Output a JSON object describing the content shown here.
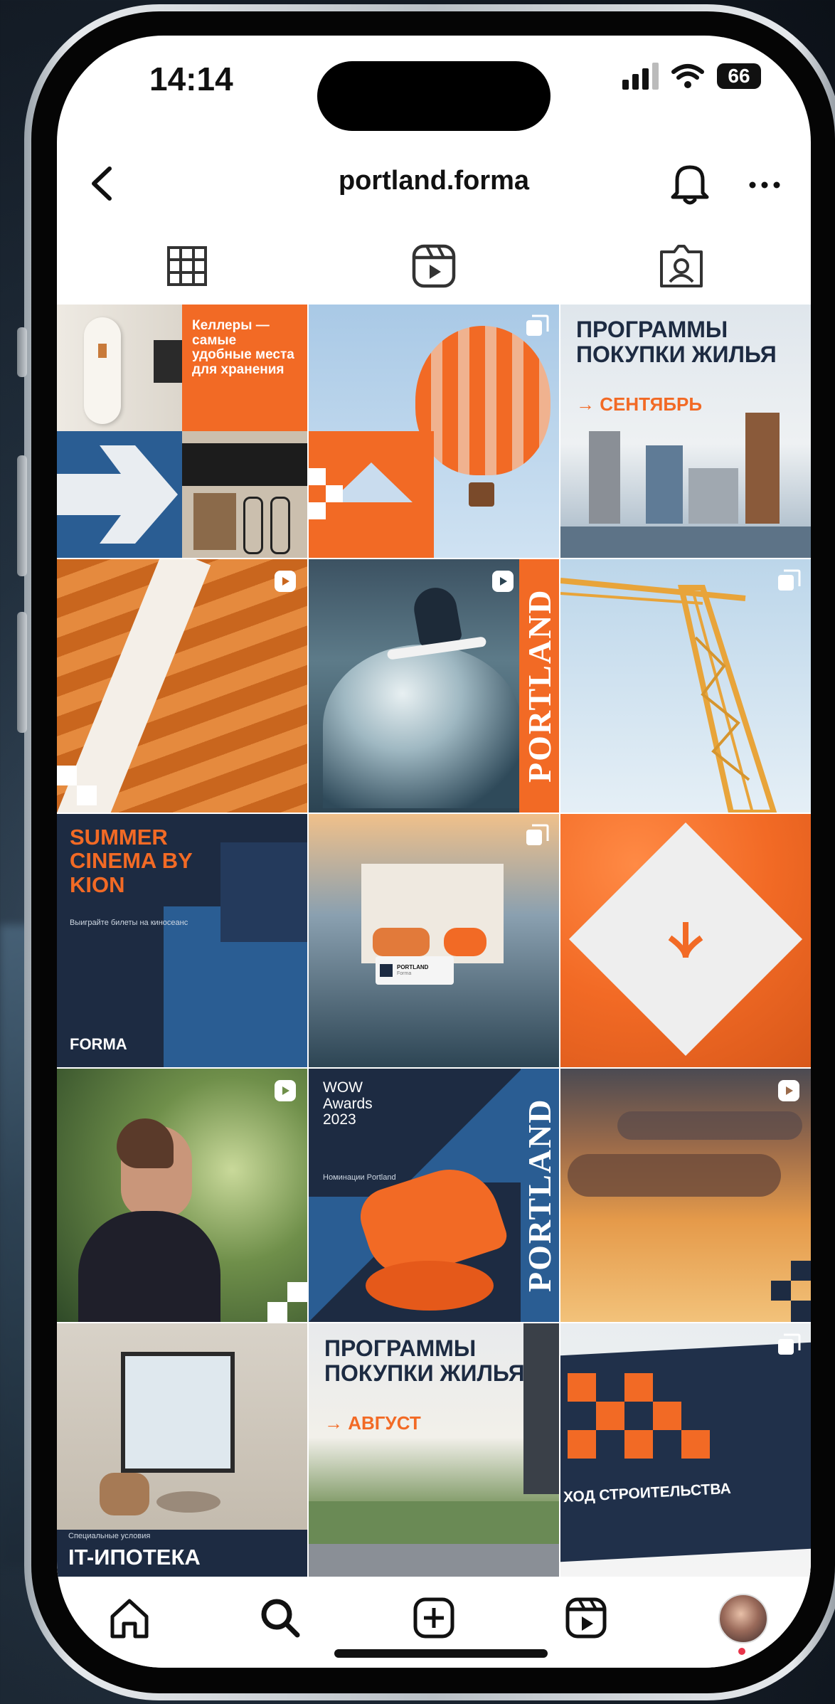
{
  "status": {
    "time": "14:14",
    "battery": "66"
  },
  "header": {
    "username": "portland.forma"
  },
  "posts": [
    {
      "id": "cellars",
      "text": "Келлеры — самые удобные места для хранения",
      "badge": "none"
    },
    {
      "id": "balloon",
      "badge": "carousel"
    },
    {
      "id": "programs-sept",
      "title": "ПРОГРАММЫ ПОКУПКИ ЖИЛЬЯ",
      "subtitle": "→ СЕНТЯБРЬ",
      "badge": "none"
    },
    {
      "id": "stairs",
      "badge": "reel"
    },
    {
      "id": "surfer",
      "side_text": "PORTLAND",
      "badge": "reel"
    },
    {
      "id": "crane",
      "badge": "carousel"
    },
    {
      "id": "summer-cinema",
      "title": "SUMMER CINEMA BY KION",
      "subtitle": "Выиграйте билеты на киносеанс",
      "footer": "FORMA",
      "badge": "none"
    },
    {
      "id": "interior-sea",
      "card_title": "PORTLAND",
      "card_sub": "Forma",
      "badge": "carousel"
    },
    {
      "id": "logo-diamond",
      "badge": "none"
    },
    {
      "id": "woman",
      "badge": "reel"
    },
    {
      "id": "wow-awards",
      "title": "WOW Awards 2023",
      "subtitle": "Номинации Portland",
      "side_text": "PORTLAND",
      "badge": "none"
    },
    {
      "id": "sunset",
      "badge": "reel"
    },
    {
      "id": "it-mortgage",
      "subtitle": "Специальные условия",
      "title": "IT-ИПОТЕКА",
      "badge": "none"
    },
    {
      "id": "programs-aug",
      "title": "ПРОГРАММЫ ПОКУПКИ ЖИЛЬЯ",
      "subtitle": "→ АВГУСТ",
      "badge": "none"
    },
    {
      "id": "construction",
      "title": "ХОД СТРОИТЕЛЬСТВА",
      "badge": "carousel"
    }
  ],
  "colors": {
    "accent_orange": "#f26a25",
    "navy": "#1d2b42",
    "blue": "#2a5d93"
  }
}
